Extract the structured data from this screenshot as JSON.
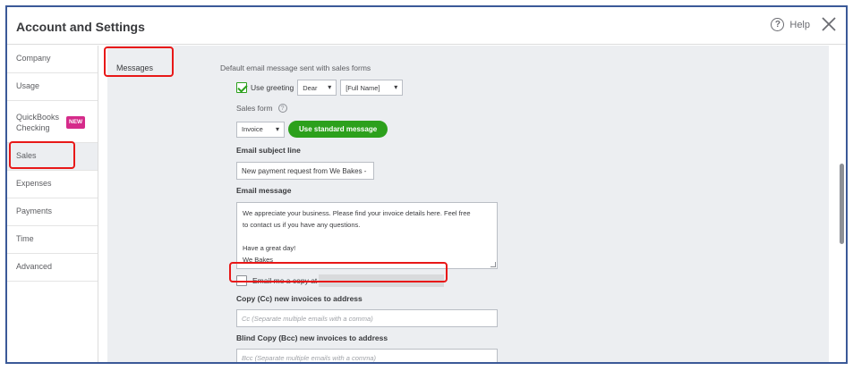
{
  "header": {
    "title": "Account and Settings",
    "help_label": "Help",
    "help_icon": "?",
    "close_icon": "close-icon"
  },
  "sidebar": {
    "items": [
      {
        "label": "Company"
      },
      {
        "label": "Usage"
      },
      {
        "label": "QuickBooks Checking",
        "badge": "NEW"
      },
      {
        "label": "Sales"
      },
      {
        "label": "Expenses"
      },
      {
        "label": "Payments"
      },
      {
        "label": "Time"
      },
      {
        "label": "Advanced"
      }
    ],
    "active": "Sales"
  },
  "section": {
    "label": "Messages",
    "description": "Default email message sent with sales forms"
  },
  "greeting": {
    "checkbox_label": "Use greeting",
    "checked": true,
    "salutation": "Dear",
    "name_field": "[Full Name]"
  },
  "sales_form": {
    "label": "Sales form",
    "info_icon": "?",
    "selected": "Invoice",
    "standard_button": "Use standard message"
  },
  "subject": {
    "label": "Email subject line",
    "value": "New payment request from We Bakes -"
  },
  "message": {
    "label": "Email message",
    "line1": "We appreciate your business. Please find your invoice details here. Feel free",
    "line2": "to contact us if you have any questions.",
    "line3": "Have a great day!",
    "line4": "We Bakes"
  },
  "copy_me": {
    "label": "Email me a copy at",
    "checked": false
  },
  "cc": {
    "label": "Copy (Cc) new invoices to address",
    "placeholder": "Cc (Separate multiple emails with a comma)"
  },
  "bcc": {
    "label": "Blind Copy (Bcc) new invoices to address",
    "placeholder": "Bcc (Separate multiple emails with a comma)"
  },
  "colors": {
    "accent_green": "#2ca01c",
    "highlight_red": "#e81818",
    "frame_blue": "#3b5998",
    "badge_pink": "#d52b8a"
  }
}
